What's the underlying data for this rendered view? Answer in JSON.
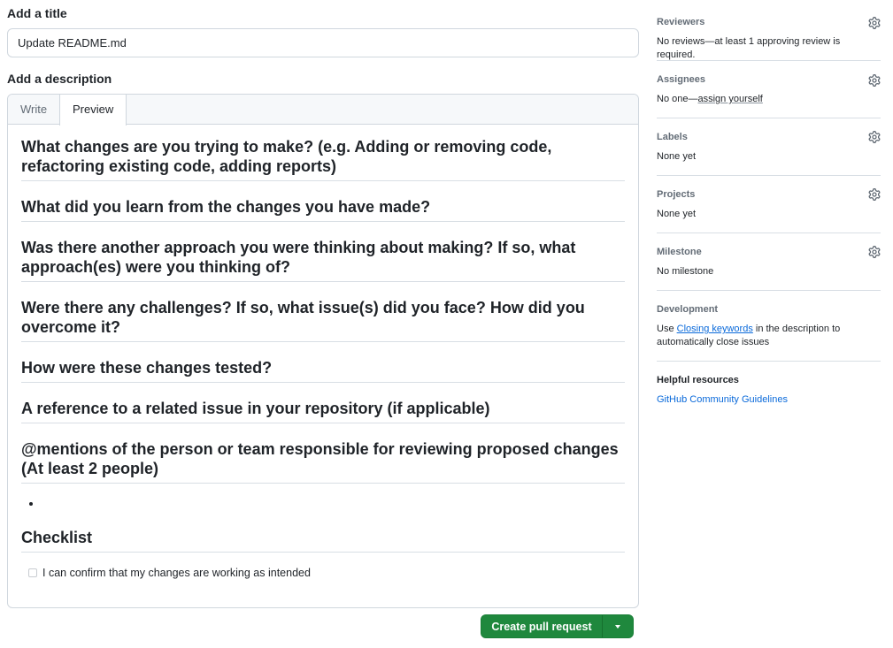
{
  "form": {
    "title_label": "Add a title",
    "title_value": "Update README.md",
    "description_label": "Add a description",
    "tabs": [
      {
        "label": "Write",
        "active": false
      },
      {
        "label": "Preview",
        "active": true
      }
    ],
    "preview": {
      "headings": [
        "What changes are you trying to make? (e.g. Adding or removing code, refactoring existing code, adding reports)",
        "What did you learn from the changes you have made?",
        "Was there another approach you were thinking about making? If so, what approach(es) were you thinking of?",
        "Were there any challenges? If so, what issue(s) did you face? How did you overcome it?",
        "How were these changes tested?",
        "A reference to a related issue in your repository (if applicable)",
        "@mentions of the person or team responsible for reviewing proposed changes (At least 2 people)"
      ],
      "checklist_heading": "Checklist",
      "checklist_items": [
        {
          "label": "I can confirm that my changes are working as intended",
          "checked": false
        }
      ]
    },
    "create_button_label": "Create pull request"
  },
  "sidebar": {
    "reviewers": {
      "title": "Reviewers",
      "value": "No reviews—at least 1 approving review is required."
    },
    "assignees": {
      "title": "Assignees",
      "value_prefix": "No one—",
      "value_link": "assign yourself"
    },
    "labels": {
      "title": "Labels",
      "value": "None yet"
    },
    "projects": {
      "title": "Projects",
      "value": "None yet"
    },
    "milestone": {
      "title": "Milestone",
      "value": "No milestone"
    },
    "development": {
      "title": "Development",
      "text_before": "Use ",
      "link": "Closing keywords",
      "text_after": " in the description to automatically close issues"
    },
    "helpful": {
      "title": "Helpful resources",
      "link": "GitHub Community Guidelines"
    }
  },
  "colors": {
    "primary_button": "#1f883d",
    "link": "#0969da",
    "border": "#d0d7de",
    "muted_text": "#636c76"
  }
}
